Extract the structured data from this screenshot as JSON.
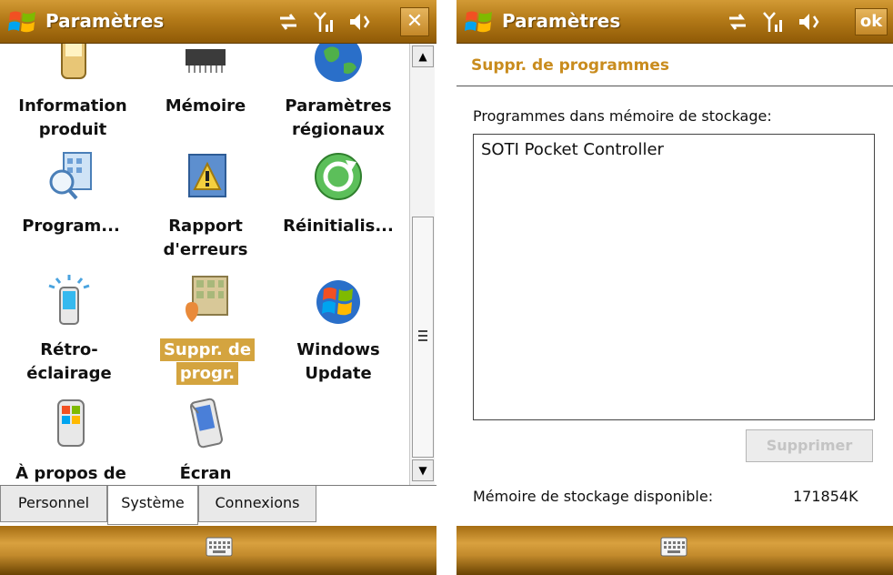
{
  "left_screen": {
    "title": "Paramètres",
    "close_label": "✕",
    "status_icons": [
      "sync-icon",
      "signal-icon",
      "speaker-icon"
    ],
    "items": [
      {
        "label_lines": [
          "Information",
          "produit"
        ],
        "icon": "device-info-icon"
      },
      {
        "label_lines": [
          "Mémoire",
          ""
        ],
        "icon": "memory-chip-icon"
      },
      {
        "label_lines": [
          "Paramètres",
          "régionaux"
        ],
        "icon": "globe-icon"
      },
      {
        "label_lines": [
          "Program...",
          ""
        ],
        "icon": "programs-icon"
      },
      {
        "label_lines": [
          "Rapport",
          "d'erreurs"
        ],
        "icon": "error-report-icon"
      },
      {
        "label_lines": [
          "Réinitialis...",
          ""
        ],
        "icon": "reset-icon"
      },
      {
        "label_lines": [
          "Rétro-",
          "éclairage"
        ],
        "icon": "backlight-icon"
      },
      {
        "label_lines": [
          "Suppr. de",
          "progr."
        ],
        "icon": "remove-programs-icon",
        "selected": true
      },
      {
        "label_lines": [
          "Windows",
          "Update"
        ],
        "icon": "windows-update-icon"
      },
      {
        "label_lines": [
          "À propos de",
          ""
        ],
        "icon": "about-device-icon"
      },
      {
        "label_lines": [
          "Écran",
          ""
        ],
        "icon": "screen-icon"
      }
    ],
    "tabs": [
      {
        "label": "Personnel"
      },
      {
        "label": "Système",
        "active": true
      },
      {
        "label": "Connexions"
      }
    ]
  },
  "right_screen": {
    "title": "Paramètres",
    "ok_label": "ok",
    "subtitle": "Suppr. de programmes",
    "list_label": "Programmes dans mémoire de stockage:",
    "programs": [
      "SOTI Pocket Controller"
    ],
    "remove_button": "Supprimer",
    "memory_label": "Mémoire de stockage disponible:",
    "memory_value": "171854K"
  },
  "colors": {
    "accent": "#c98c1e",
    "titlebar": "#b47a18",
    "selection": "#d4a43f"
  }
}
